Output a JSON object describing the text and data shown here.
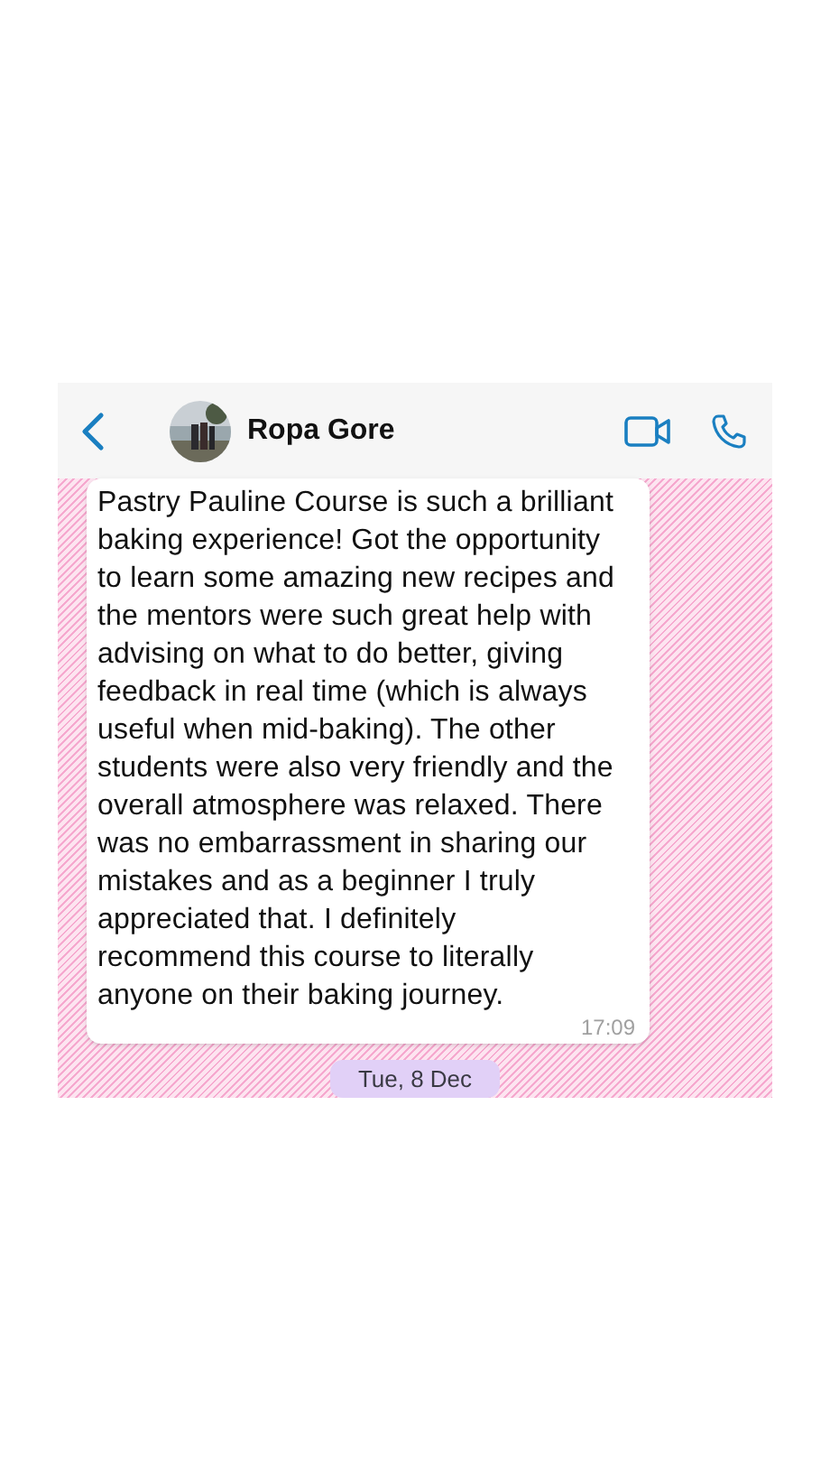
{
  "header": {
    "contact_name": "Ropa Gore"
  },
  "messages": [
    {
      "text": "Pastry Pauline Course is such a brilliant baking experience! Got the opportunity to learn some amazing new recipes and the mentors were such great help with advising on what to do better, giving feedback in real time (which is always useful when mid-baking). The other students were also very friendly and the overall atmosphere was relaxed. There was no embarrassment in sharing our mistakes and as a beginner I truly appreciated that. I definitely recommend this course to literally anyone on their baking journey.",
      "time": "17:09"
    }
  ],
  "date_label": "Tue, 8 Dec"
}
